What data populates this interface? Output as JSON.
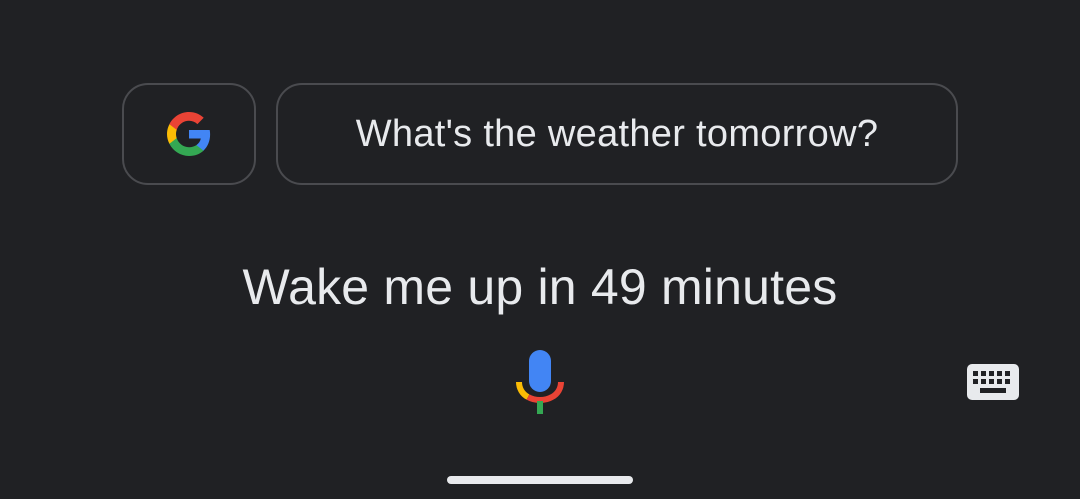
{
  "suggestion_chip": {
    "label": "What's the weather tomorrow?"
  },
  "google_chip": {
    "icon": "google-g-icon"
  },
  "query": {
    "text": "Wake me up in 49 minutes"
  },
  "mic": {
    "icon": "microphone-icon"
  },
  "keyboard": {
    "icon": "keyboard-icon"
  },
  "colors": {
    "background": "#202124",
    "text": "#e8eaed",
    "chip_border": "#4a4b4f",
    "google_blue": "#4285F4",
    "google_red": "#EA4335",
    "google_yellow": "#FBBC05",
    "google_green": "#34A853"
  }
}
